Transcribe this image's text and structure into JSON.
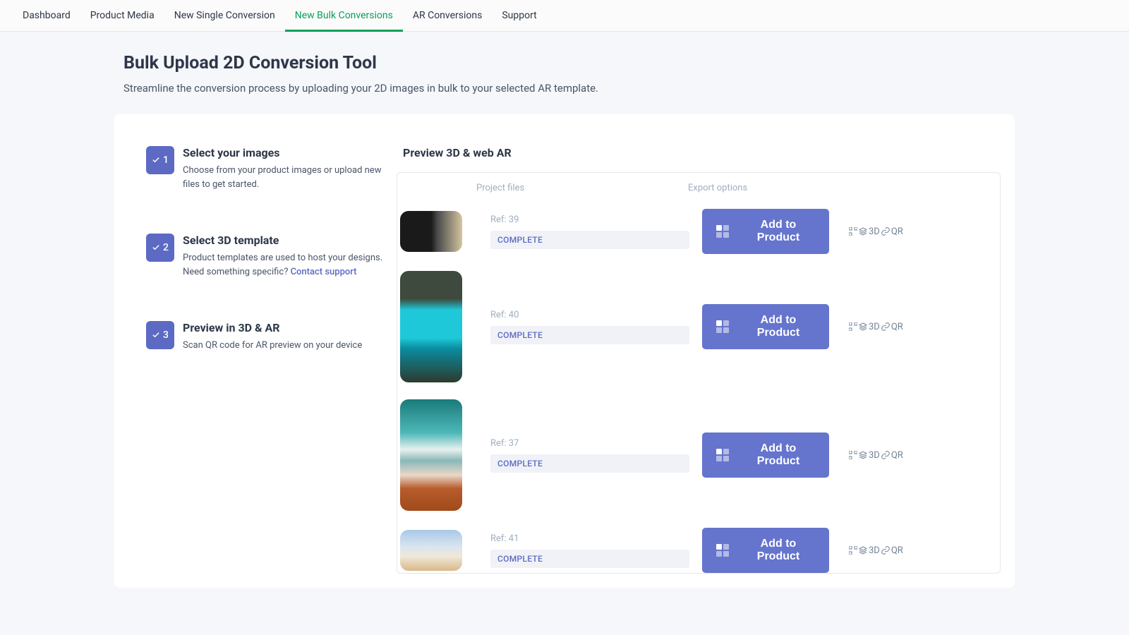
{
  "nav": {
    "items": [
      {
        "label": "Dashboard",
        "active": false
      },
      {
        "label": "Product Media",
        "active": false
      },
      {
        "label": "New Single Conversion",
        "active": false
      },
      {
        "label": "New Bulk Conversions",
        "active": true
      },
      {
        "label": "AR Conversions",
        "active": false
      },
      {
        "label": "Support",
        "active": false
      }
    ]
  },
  "header": {
    "title": "Bulk Upload 2D Conversion Tool",
    "subtitle": "Streamline the conversion process by uploading your 2D images in bulk to your selected AR template."
  },
  "steps": [
    {
      "num": "1",
      "title": "Select your images",
      "desc": "Choose from your product images or upload new files to get started."
    },
    {
      "num": "2",
      "title": "Select 3D template",
      "desc": "Product templates are used to host your designs. Need something specific? ",
      "link": "Contact support"
    },
    {
      "num": "3",
      "title": "Preview in 3D & AR",
      "desc": "Scan QR code for AR preview on your device"
    }
  ],
  "preview": {
    "title": "Preview 3D & web AR",
    "cols": {
      "files": "Project files",
      "export": "Export options"
    },
    "rows": [
      {
        "ref": "Ref: 39",
        "status": "COMPLETE",
        "btn": "Add to Product"
      },
      {
        "ref": "Ref: 40",
        "status": "COMPLETE",
        "btn": "Add to Product"
      },
      {
        "ref": "Ref: 37",
        "status": "COMPLETE",
        "btn": "Add to Product"
      },
      {
        "ref": "Ref: 41",
        "status": "COMPLETE",
        "btn": "Add to Product"
      }
    ],
    "links": {
      "d3": "3D",
      "qr": "QR"
    }
  }
}
